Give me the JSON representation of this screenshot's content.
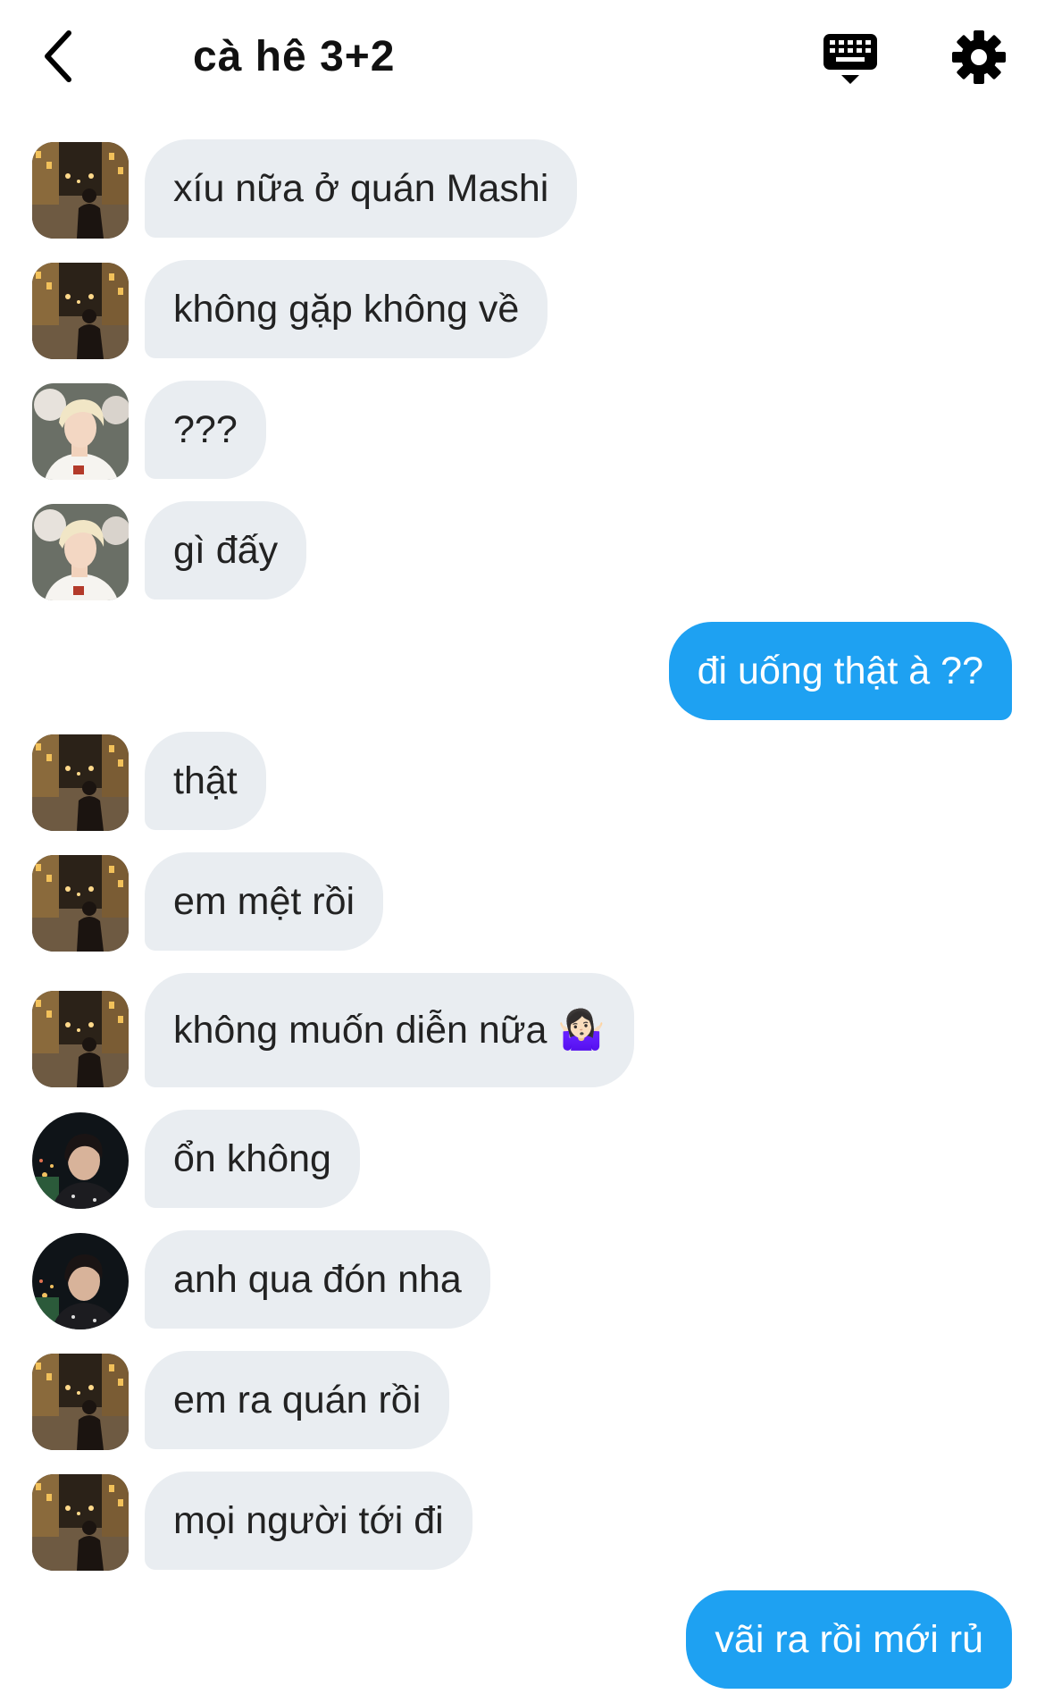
{
  "header": {
    "title": "cà hê 3+2",
    "back_icon": "chevron-left-icon",
    "keyboard_icon": "keyboard-icon",
    "settings_icon": "gear-icon"
  },
  "colors": {
    "incoming_bubble": "#e9edf1",
    "outgoing_bubble": "#1ea1f2",
    "text": "#222222"
  },
  "messages": [
    {
      "sender": "street-avatar",
      "direction": "incoming",
      "text": "xíu nữa ở quán Mashi"
    },
    {
      "sender": "street-avatar",
      "direction": "incoming",
      "text": "không gặp không về"
    },
    {
      "sender": "blonde-avatar",
      "direction": "incoming",
      "text": "???"
    },
    {
      "sender": "blonde-avatar",
      "direction": "incoming",
      "text": "gì đấy"
    },
    {
      "sender": "me",
      "direction": "outgoing",
      "text": "đi uống thật à ??"
    },
    {
      "sender": "street-avatar",
      "direction": "incoming",
      "text": "thật"
    },
    {
      "sender": "street-avatar",
      "direction": "incoming",
      "text": "em mệt rồi"
    },
    {
      "sender": "street-avatar",
      "direction": "incoming",
      "text": "không muốn diễn nữa 🤷🏻‍♀️"
    },
    {
      "sender": "night-avatar",
      "direction": "incoming",
      "text": "ổn không"
    },
    {
      "sender": "night-avatar",
      "direction": "incoming",
      "text": "anh qua đón nha"
    },
    {
      "sender": "street-avatar",
      "direction": "incoming",
      "text": "em ra quán rồi"
    },
    {
      "sender": "street-avatar",
      "direction": "incoming",
      "text": "mọi người tới đi"
    },
    {
      "sender": "me",
      "direction": "outgoing",
      "text": "vãi ra rồi mới rủ"
    }
  ]
}
